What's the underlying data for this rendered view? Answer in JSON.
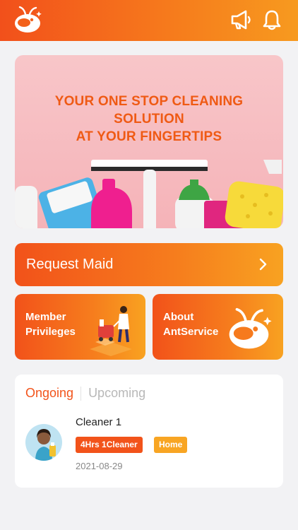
{
  "header": {
    "logo_icon": "ant-logo-icon",
    "announcement_icon": "megaphone-icon",
    "notification_icon": "bell-icon"
  },
  "banner": {
    "title_line1": "YOUR ONE STOP CLEANING SOLUTION",
    "title_line2": "AT YOUR FINGERTIPS",
    "active_slide": 1,
    "slide_count": 3
  },
  "request": {
    "label": "Request Maid",
    "icon": "chevron-right-icon"
  },
  "tiles": [
    {
      "line1": "Member",
      "line2": "Privileges",
      "icon": "cleaner-illustration"
    },
    {
      "line1": "About",
      "line2": "AntService",
      "icon": "ant-logo-icon"
    }
  ],
  "orders": {
    "tabs": [
      {
        "label": "Ongoing",
        "active": true
      },
      {
        "label": "Upcoming",
        "active": false
      }
    ],
    "items": [
      {
        "name": "Cleaner 1",
        "duration_badge": "4Hrs 1Cleaner",
        "type_badge": "Home",
        "date": "2021-08-29"
      }
    ]
  },
  "colors": {
    "primary": "#f2531a",
    "secondary": "#f8a523",
    "background": "#f2f2f4"
  }
}
